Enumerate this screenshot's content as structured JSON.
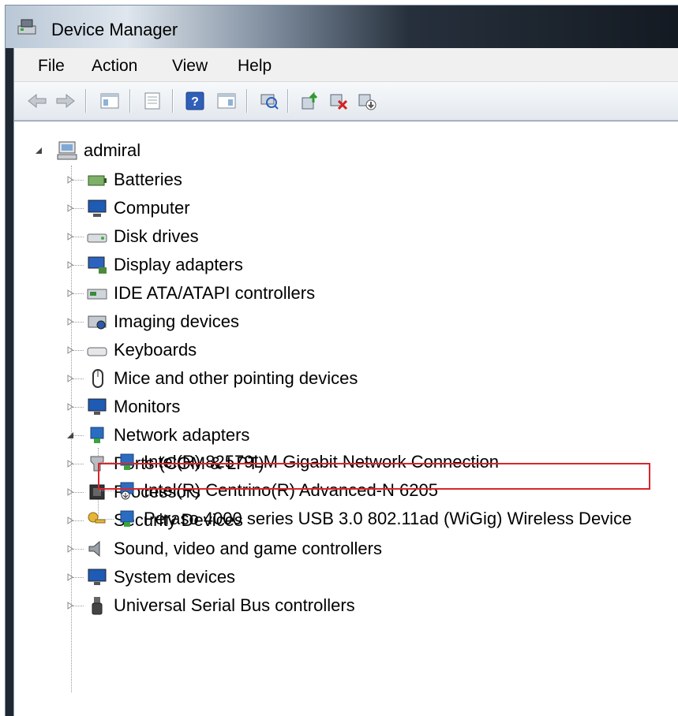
{
  "window": {
    "title": "Device Manager"
  },
  "menu": [
    "File",
    "Action",
    "View",
    "Help"
  ],
  "toolbar": {
    "buttons": [
      "back-icon",
      "forward-icon",
      "show-hide-tree-icon",
      "properties-icon",
      "help-icon",
      "action-pane-icon",
      "scan-hardware-icon",
      "update-driver-icon",
      "uninstall-icon",
      "disable-icon"
    ]
  },
  "tree": {
    "root": "admiral",
    "categories": [
      {
        "label": "Batteries"
      },
      {
        "label": "Computer"
      },
      {
        "label": "Disk drives"
      },
      {
        "label": "Display adapters"
      },
      {
        "label": "IDE ATA/ATAPI controllers"
      },
      {
        "label": "Imaging devices"
      },
      {
        "label": "Keyboards"
      },
      {
        "label": "Mice and other pointing devices"
      },
      {
        "label": "Monitors"
      },
      {
        "label": "Network adapters"
      },
      {
        "label": "Ports (COM & LPT)"
      },
      {
        "label": "Processors"
      },
      {
        "label": "Security Devices"
      },
      {
        "label": "Sound, video and game controllers"
      },
      {
        "label": "System devices"
      },
      {
        "label": "Universal Serial Bus controllers"
      }
    ],
    "network_children": [
      {
        "label": "Intel(R) 82579LM Gigabit Network Connection"
      },
      {
        "label": "Intel(R) Centrino(R) Advanced-N 6205"
      },
      {
        "label": "Peraso 4000 series USB 3.0 802.11ad (WiGig) Wireless Device"
      }
    ]
  },
  "colors": {
    "highlight_border": "#d9262c",
    "accent": "#1e5bb5"
  }
}
